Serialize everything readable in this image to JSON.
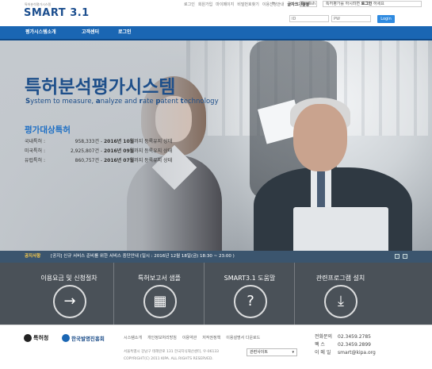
{
  "header": {
    "logo_sub": "특허분석평가시스템",
    "logo_main": "SMART",
    "logo_version": "3.1",
    "top_links": [
      "로그인",
      "회원가입",
      "마이페이지",
      "비밀번호찾기",
      "이용신청안내",
      "글자크기설정"
    ],
    "font_controls": [
      "+",
      "-"
    ],
    "lang_button": "English",
    "favorite_text": "특허평가를 하시려면",
    "favorite_bold": "로그인",
    "favorite_tail": "하세요",
    "id_placeholder": "ID",
    "pw_placeholder": "PW",
    "login_button": "Login"
  },
  "nav": {
    "items": [
      "평가시스템소개",
      "고객센터",
      "로그인"
    ]
  },
  "hero": {
    "title": "특허분석평가시스템",
    "subtitle_parts": [
      {
        "b": "S",
        "t": "ystem to measure, "
      },
      {
        "b": "a",
        "t": "nalyze and "
      },
      {
        "b": "r",
        "t": "ate "
      },
      {
        "b": "p",
        "t": "atent "
      },
      {
        "b": "t",
        "t": "echnology"
      }
    ],
    "target_title": "평가대상특허",
    "stats": [
      {
        "label": "국내특허 :",
        "count": "958,333건",
        "year": "2016년 10월",
        "rest": "까지 등록유지 상태"
      },
      {
        "label": "미국특허 :",
        "count": "2,925,807건",
        "year": "2016년 09월",
        "rest": "까지 등록유지 상태"
      },
      {
        "label": "유럽특허 :",
        "count": "860,757건",
        "year": "2016년 07월",
        "rest": "까지 등록유지 상태"
      }
    ]
  },
  "notice": {
    "tag": "공지사항",
    "text": "[공지] 신규 서비스 준비를 위한 서비스 중단안내 (일시 : 2016년 12월 18일(금) 18:30 ~ 23:00 )",
    "prev": "‹",
    "next": "›"
  },
  "quick_menu": [
    {
      "label": "이용요금 및 신청절차",
      "icon": "→"
    },
    {
      "label": "특허보고서 샘플",
      "icon": "▦"
    },
    {
      "label": "SMART3.1 도움말",
      "icon": "?"
    },
    {
      "label": "관련프로그램 설치",
      "icon": "⤓"
    }
  ],
  "footer": {
    "logo1": "특허청",
    "logo2": "한국발명진흥회",
    "links": [
      "시스템소개",
      "개인정보처리방침",
      "이용약관",
      "저작권정책",
      "이용설명서 다운로드"
    ],
    "address": "서울특별시 강남구 테헤란로 131 한국지식재산센터, 우-06133",
    "copyright": "COPYRIGHT(C) 2011 KIPA. ALL RIGHTS RESERVED.",
    "related_sites": "관련사이트",
    "contact": [
      {
        "label": "전화문의",
        "value": "02.3459.2785"
      },
      {
        "label": "팩 스",
        "value": "02.3459.2899"
      },
      {
        "label": "이 메 일",
        "value": "smart@kipa.org"
      }
    ]
  },
  "colors": {
    "brand_blue": "#1a66b3",
    "nav_blue": "#1a66b3",
    "quick_bg": "#4a5158"
  }
}
